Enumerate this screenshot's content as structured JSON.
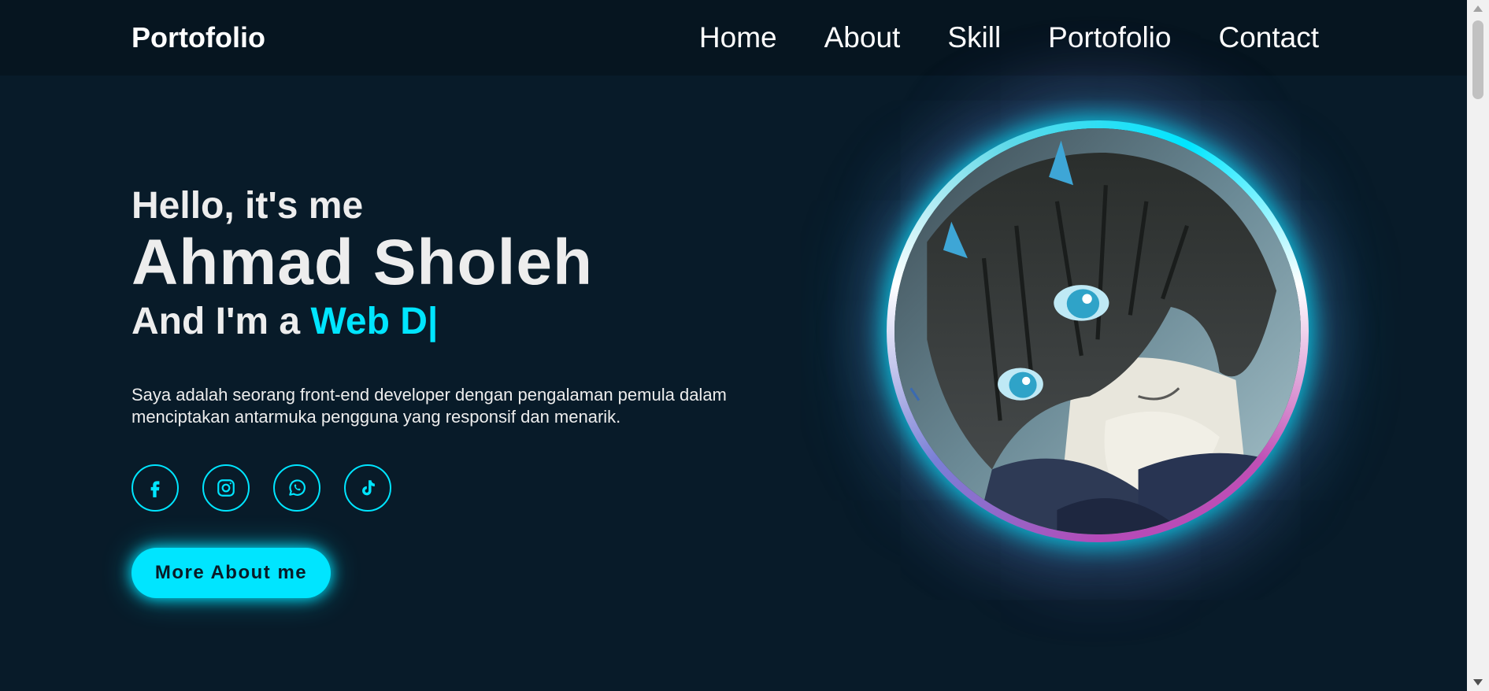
{
  "header": {
    "logo": "Portofolio",
    "nav": [
      "Home",
      "About",
      "Skill",
      "Portofolio",
      "Contact"
    ]
  },
  "hero": {
    "greeting": "Hello, it's me",
    "name": "Ahmad Sholeh",
    "role_prefix": "And I'm a ",
    "role_typed": "Web D|",
    "description": "Saya adalah seorang front-end developer dengan pengalaman pemula dalam menciptakan antarmuka pengguna yang responsif dan menarik.",
    "socials": [
      "facebook-icon",
      "instagram-icon",
      "whatsapp-icon",
      "tiktok-icon"
    ],
    "button_label": "More About me"
  },
  "colors": {
    "background": "#081b29",
    "header": "#061520",
    "accent": "#00e5ff",
    "text": "#ededed"
  }
}
